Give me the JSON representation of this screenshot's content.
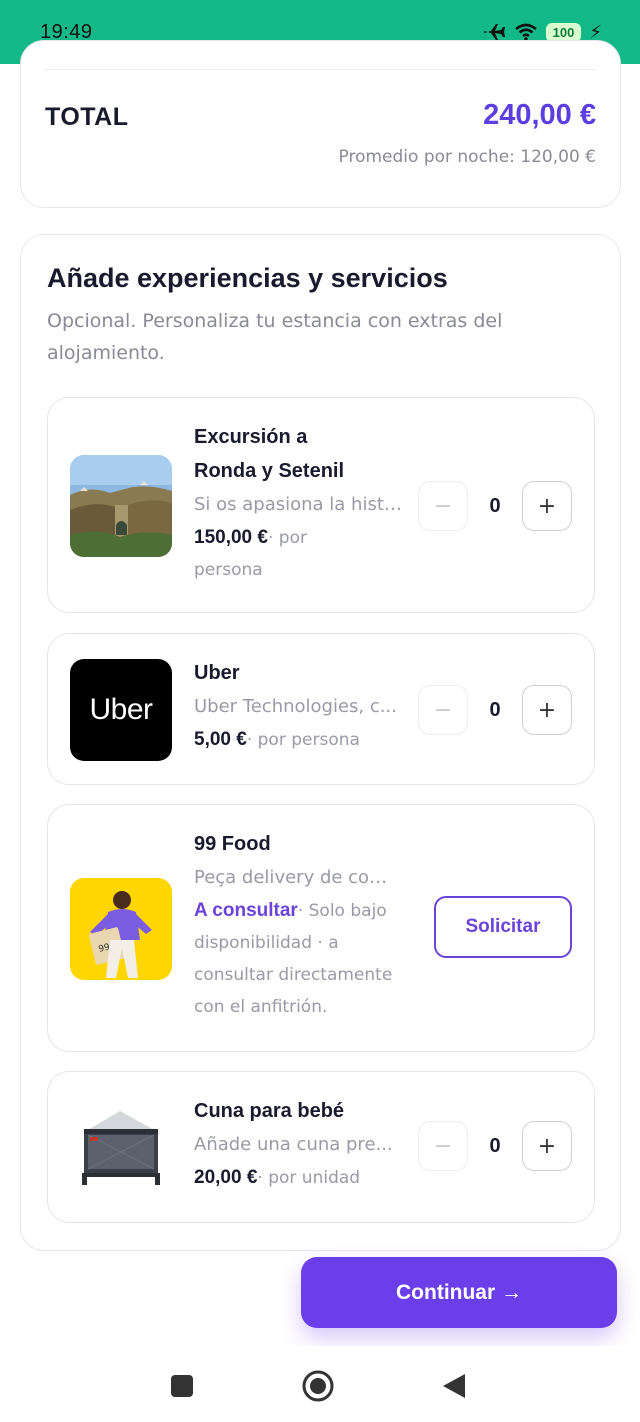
{
  "status_bar": {
    "time": "19:49",
    "battery": "100",
    "bg_color": "#12b886"
  },
  "summary": {
    "total_label": "TOTAL",
    "total_amount": "240,00 €",
    "average_per_night": "Promedio por noche: 120,00 €",
    "accent_color": "#5b3ee0"
  },
  "extras": {
    "title": "Añade experiencias y servicios",
    "subtitle": "Opcional. Personaliza tu estancia con extras del alojamiento.",
    "items": [
      {
        "name_line1": "Excursión a",
        "name_line2": "Ronda y Setenil",
        "description": "Si os apasiona la historia...",
        "price": "150,00 €",
        "price_unit_line1": "· por",
        "price_unit_line2": "persona",
        "quantity": "0",
        "minus": "−",
        "plus": "+",
        "image_icon": "ronda-bridge-photo"
      },
      {
        "name": "Uber",
        "description": "Uber Technologies, c...",
        "price": "5,00 €",
        "price_unit": "· por persona",
        "quantity": "0",
        "minus": "−",
        "plus": "+",
        "logo_text": "Uber"
      },
      {
        "name": "99 Food",
        "description": "Peça delivery de comida",
        "consult_label": "A consultar",
        "consult_note_1": "· Solo bajo",
        "consult_note_2": "disponibilidad · a",
        "consult_note_3": "consultar directamente",
        "consult_note_4": "con el anfitrión.",
        "request_label": "Solicitar",
        "image_icon": "99food-courier-photo"
      },
      {
        "name": "Cuna para bebé",
        "description": "Añade una cuna pre...",
        "price": "20,00 €",
        "price_unit": "· por unidad",
        "quantity": "0",
        "minus": "−",
        "plus": "+",
        "image_icon": "baby-crib-photo"
      }
    ]
  },
  "cta": {
    "continue_label": "Continuar →",
    "color": "#6a3ee8"
  },
  "nav": {
    "recents_icon": "square-icon",
    "home_icon": "circle-icon",
    "back_icon": "triangle-back-icon"
  }
}
